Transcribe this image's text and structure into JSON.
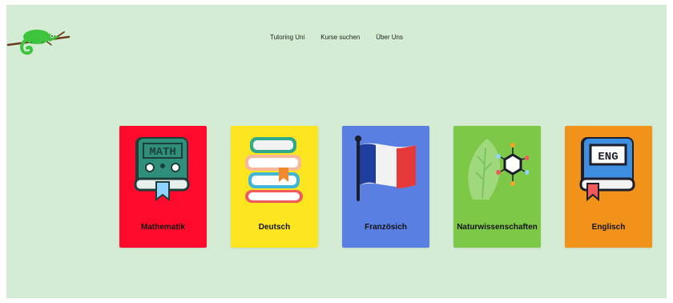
{
  "nav": {
    "items": [
      {
        "label": "Tutoring Uni"
      },
      {
        "label": "Kurse suchen"
      },
      {
        "label": "Über Uns"
      }
    ]
  },
  "cards": [
    {
      "label": "Mathematik",
      "color": "#ff0a2c",
      "icon": "math-book-icon",
      "icon_text": "MATH"
    },
    {
      "label": "Deutsch",
      "color": "#fde51f",
      "icon": "book-stack-icon"
    },
    {
      "label": "Französich",
      "color": "#5a7fe3",
      "icon": "french-flag-icon"
    },
    {
      "label": "Naturwissenschaften",
      "color": "#7dc846",
      "icon": "leaf-molecule-icon"
    },
    {
      "label": "Englisch",
      "color": "#f1931b",
      "icon": "english-book-icon",
      "icon_text": "ENG"
    }
  ]
}
